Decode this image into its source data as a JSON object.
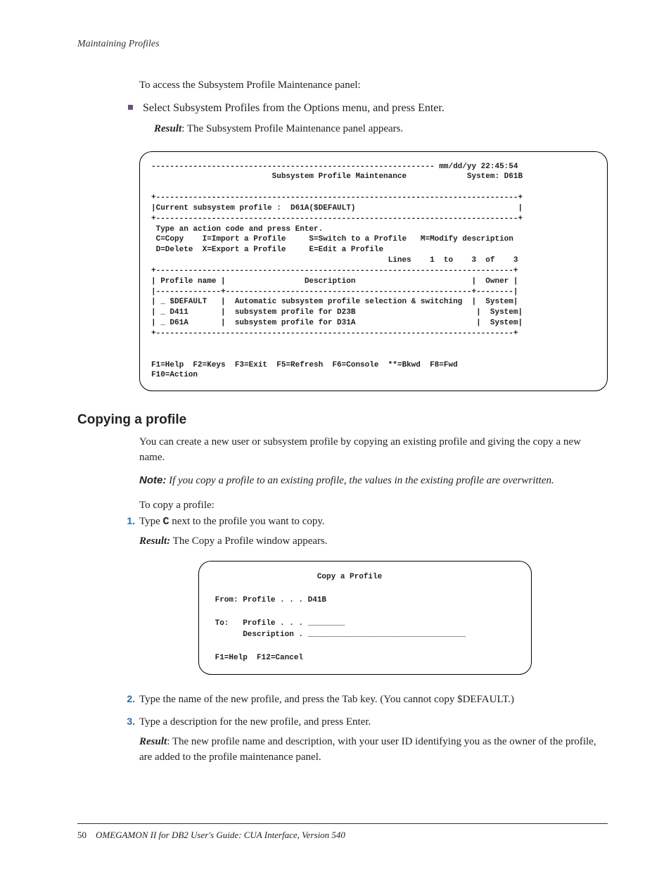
{
  "header": {
    "running": "Maintaining Profiles"
  },
  "intro": {
    "access_line": "To access the Subsystem Profile Maintenance panel:",
    "bullet1": "Select Subsystem Profiles from the Options menu, and press Enter.",
    "result_label": "Result",
    "result1_text": ": The Subsystem Profile Maintenance panel appears."
  },
  "terminal1": "------------------------------------------------------------- mm/dd/yy 22:45:54\n                          Subsystem Profile Maintenance             System: D61B\n\n+------------------------------------------------------------------------------+\n|Current subsystem profile :  D61A($DEFAULT)                                   |\n+------------------------------------------------------------------------------+\n Type an action code and press Enter.\n C=Copy    I=Import a Profile     S=Switch to a Profile   M=Modify description\n D=Delete  X=Export a Profile     E=Edit a Profile\n                                                   Lines    1  to    3  of    3\n+-----------------------------------------------------------------------------+\n| Profile name |                 Description                         |  Owner |\n|--------------+-----------------------------------------------------+--------|\n| _ $DEFAULT   |  Automatic subsystem profile selection & switching  |  System|\n| _ D411       |  subsystem profile for D23B                          |  System|\n| _ D61A       |  subsystem profile for D31A                          |  System|\n+-----------------------------------------------------------------------------+\n\n\nF1=Help  F2=Keys  F3=Exit  F5=Refresh  F6=Console  **=Bkwd  F8=Fwd\nF10=Action",
  "section": {
    "heading": "Copying a profile",
    "p1": "You can create a new user or subsystem profile by copying an existing profile and giving the copy a new name.",
    "note_label": "Note:",
    "note_text": "If you copy a profile to an existing profile, the values in the existing profile are overwritten.",
    "p2": "To copy a profile:"
  },
  "steps": {
    "s1_num": "1.",
    "s1_a": "Type ",
    "s1_code": "C",
    "s1_b": " next to the profile you want to copy.",
    "s1_result_label": "Result:",
    "s1_result_text": " The Copy a Profile window appears.",
    "s2_num": "2.",
    "s2_text": "Type the name of the new profile, and press the Tab key. (You cannot copy $DEFAULT.)",
    "s3_num": "3.",
    "s3_text": "Type a description for the new profile, and press Enter.",
    "s3_result_label": "Result",
    "s3_result_text": ": The new profile name and description, with your user ID identifying you as the owner of the profile, are added to the profile maintenance panel."
  },
  "terminal2": "                       Copy a Profile\n\n From: Profile . . . D41B\n\n To:   Profile . . . ________\n       Description . __________________________________\n\n F1=Help  F12=Cancel",
  "footer": {
    "pagenum": "50",
    "title": "OMEGAMON II for DB2 User's Guide: CUA Interface, Version 540"
  }
}
